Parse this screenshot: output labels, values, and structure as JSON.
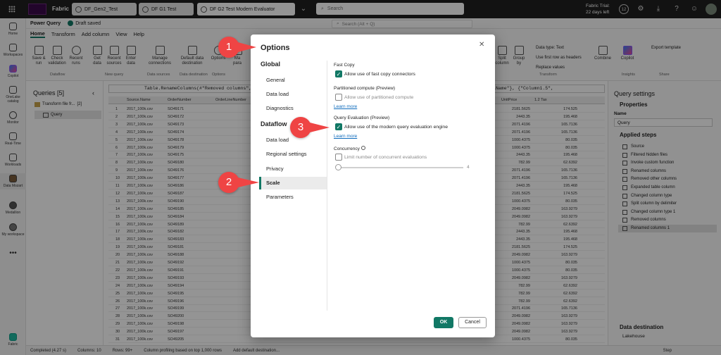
{
  "topbar": {
    "brand": "Fabric",
    "tabs": [
      "DF_Gen2_Test",
      "DF G1 Test",
      "DF G2 Test Modern Evaluator"
    ],
    "search_placeholder": "Search",
    "trial_line1": "Fabric Trial:",
    "trial_line2": "22 days left",
    "notif_count": "12"
  },
  "rail": [
    "Home",
    "Workspaces",
    "Copilot",
    "OneLake catalog",
    "Monitor",
    "Real-Time",
    "Workloads",
    "Data Mozart",
    "Medallion",
    "My workspace",
    "Fabric"
  ],
  "pq": {
    "title": "Power Query",
    "draft": "Draft saved",
    "search": "Search (Alt + Q)"
  },
  "menu": [
    "Home",
    "Transform",
    "Add column",
    "View",
    "Help"
  ],
  "ribbon": {
    "buttons": [
      "Save & run",
      "Check validation",
      "Recent runs",
      "Get data",
      "Recent sources",
      "Enter data",
      "Manage connections",
      "Default data destination",
      "Options",
      "Ma para",
      "Split column",
      "Group by",
      "Combine",
      "Copilot"
    ],
    "groups": [
      "Dataflow",
      "New query",
      "Data sources",
      "Data destination",
      "Options",
      "Transform",
      "Insights",
      "Share"
    ],
    "right_items": [
      "Data type: Text",
      "Use first row as headers",
      "Replace values",
      "Export template"
    ]
  },
  "queries": {
    "title": "Queries [5]",
    "items": [
      {
        "label": "Transform file fr...",
        "count": "[2]"
      },
      {
        "label": "Query",
        "count": ""
      }
    ]
  },
  "formula": "Table.RenameColumns(#\"Removed columns\", {{",
  "formula_right": ".4\", \"FullName\"}, {\"Column1.5\",",
  "grid": {
    "headers": [
      "Source.Name",
      "OrderNumber",
      "OrderLineNumber",
      "UnitPrice",
      "1.2 Tax"
    ],
    "rows": [
      [
        "1",
        "2017_100k.csv",
        "SO49171",
        "2181.5625",
        "174.525"
      ],
      [
        "2",
        "2017_100k.csv",
        "SO49172",
        "2443.35",
        "195.468"
      ],
      [
        "3",
        "2017_100k.csv",
        "SO49173",
        "2071.4196",
        "165.7136"
      ],
      [
        "4",
        "2017_100k.csv",
        "SO49174",
        "2071.4196",
        "165.7136"
      ],
      [
        "5",
        "2017_100k.csv",
        "SO49178",
        "1000.4375",
        "80.035"
      ],
      [
        "6",
        "2017_100k.csv",
        "SO49179",
        "1000.4375",
        "80.035"
      ],
      [
        "7",
        "2017_100k.csv",
        "SO49175",
        "2443.35",
        "195.468"
      ],
      [
        "8",
        "2017_100k.csv",
        "SO49180",
        "782.99",
        "62.6392"
      ],
      [
        "9",
        "2017_100k.csv",
        "SO49176",
        "2071.4196",
        "165.7136"
      ],
      [
        "10",
        "2017_100k.csv",
        "SO49177",
        "2071.4196",
        "165.7136"
      ],
      [
        "11",
        "2017_100k.csv",
        "SO49186",
        "2443.35",
        "195.468"
      ],
      [
        "12",
        "2017_100k.csv",
        "SO49187",
        "2181.5625",
        "174.525"
      ],
      [
        "13",
        "2017_100k.csv",
        "SO49190",
        "1000.4375",
        "80.035"
      ],
      [
        "14",
        "2017_100k.csv",
        "SO49185",
        "2049.0982",
        "163.9279"
      ],
      [
        "15",
        "2017_100k.csv",
        "SO49184",
        "2049.0982",
        "163.9279"
      ],
      [
        "16",
        "2017_100k.csv",
        "SO49189",
        "782.99",
        "62.6392"
      ],
      [
        "17",
        "2017_100k.csv",
        "SO49182",
        "2443.35",
        "195.468"
      ],
      [
        "18",
        "2017_100k.csv",
        "SO49183",
        "2443.35",
        "195.468"
      ],
      [
        "19",
        "2017_100k.csv",
        "SO49181",
        "2181.5625",
        "174.525"
      ],
      [
        "20",
        "2017_100k.csv",
        "SO49188",
        "2049.0982",
        "163.9279"
      ],
      [
        "21",
        "2017_100k.csv",
        "SO49192",
        "1000.4375",
        "80.035"
      ],
      [
        "22",
        "2017_100k.csv",
        "SO49191",
        "1000.4375",
        "80.035"
      ],
      [
        "23",
        "2017_100k.csv",
        "SO49193",
        "2049.0982",
        "163.9279"
      ],
      [
        "24",
        "2017_100k.csv",
        "SO49194",
        "782.99",
        "62.6392"
      ],
      [
        "25",
        "2017_100k.csv",
        "SO49195",
        "782.99",
        "62.6392"
      ],
      [
        "26",
        "2017_100k.csv",
        "SO49196",
        "782.99",
        "62.6392"
      ],
      [
        "27",
        "2017_100k.csv",
        "SO49199",
        "2071.4196",
        "165.7136"
      ],
      [
        "28",
        "2017_100k.csv",
        "SO49200",
        "2049.0982",
        "163.9279"
      ],
      [
        "29",
        "2017_100k.csv",
        "SO49198",
        "2049.0982",
        "163.9279"
      ],
      [
        "30",
        "2017_100k.csv",
        "SO49197",
        "2049.0982",
        "163.9279"
      ],
      [
        "31",
        "2017_100k.csv",
        "SO49205",
        "1000.4375",
        "80.035"
      ]
    ]
  },
  "settings": {
    "title": "Query settings",
    "properties": "Properties",
    "name_label": "Name",
    "name_value": "Query",
    "applied": "Applied steps",
    "steps": [
      "Source",
      "Filtered hidden files",
      "Invoke custom function",
      "Renamed columns",
      "Removed other columns",
      "Expanded table column",
      "Changed column type",
      "Split column by delimiter",
      "Changed column type 1",
      "Removed columns",
      "Renamed columns 1"
    ],
    "dest": "Data destination",
    "dest_value": "Lakehouse",
    "step_btn": "Step"
  },
  "status": [
    "Completed (4.27 s)",
    "Columns: 10",
    "Rows: 99+",
    "Column profiling based on top 1,000 rows",
    "Add default destination..."
  ],
  "dialog": {
    "title": "Options",
    "global": "Global",
    "global_items": [
      "General",
      "Data load",
      "Diagnostics"
    ],
    "dataflow": "Dataflow",
    "dataflow_items": [
      "Data load",
      "Regional settings",
      "Privacy",
      "Scale",
      "Parameters"
    ],
    "fast_copy_h": "Fast Copy",
    "fast_copy": "Allow use of fast copy connectors",
    "partitioned_h": "Partitioned compute (Preview)",
    "partitioned": "Allow use of partitioned compute",
    "learn1": "Learn more",
    "qe_h": "Query Evaluation (Preview)",
    "qe": "Allow use of the modern query evaluation engine",
    "learn2": "Learn more",
    "conc_h": "Concurrency",
    "conc": "Limit number of concurrent evaluations",
    "slider_val": "4",
    "ok": "OK",
    "cancel": "Cancel"
  },
  "callouts": [
    "1",
    "2",
    "3"
  ],
  "colors": {
    "accent": "#117865",
    "callout": "#ef4444"
  }
}
